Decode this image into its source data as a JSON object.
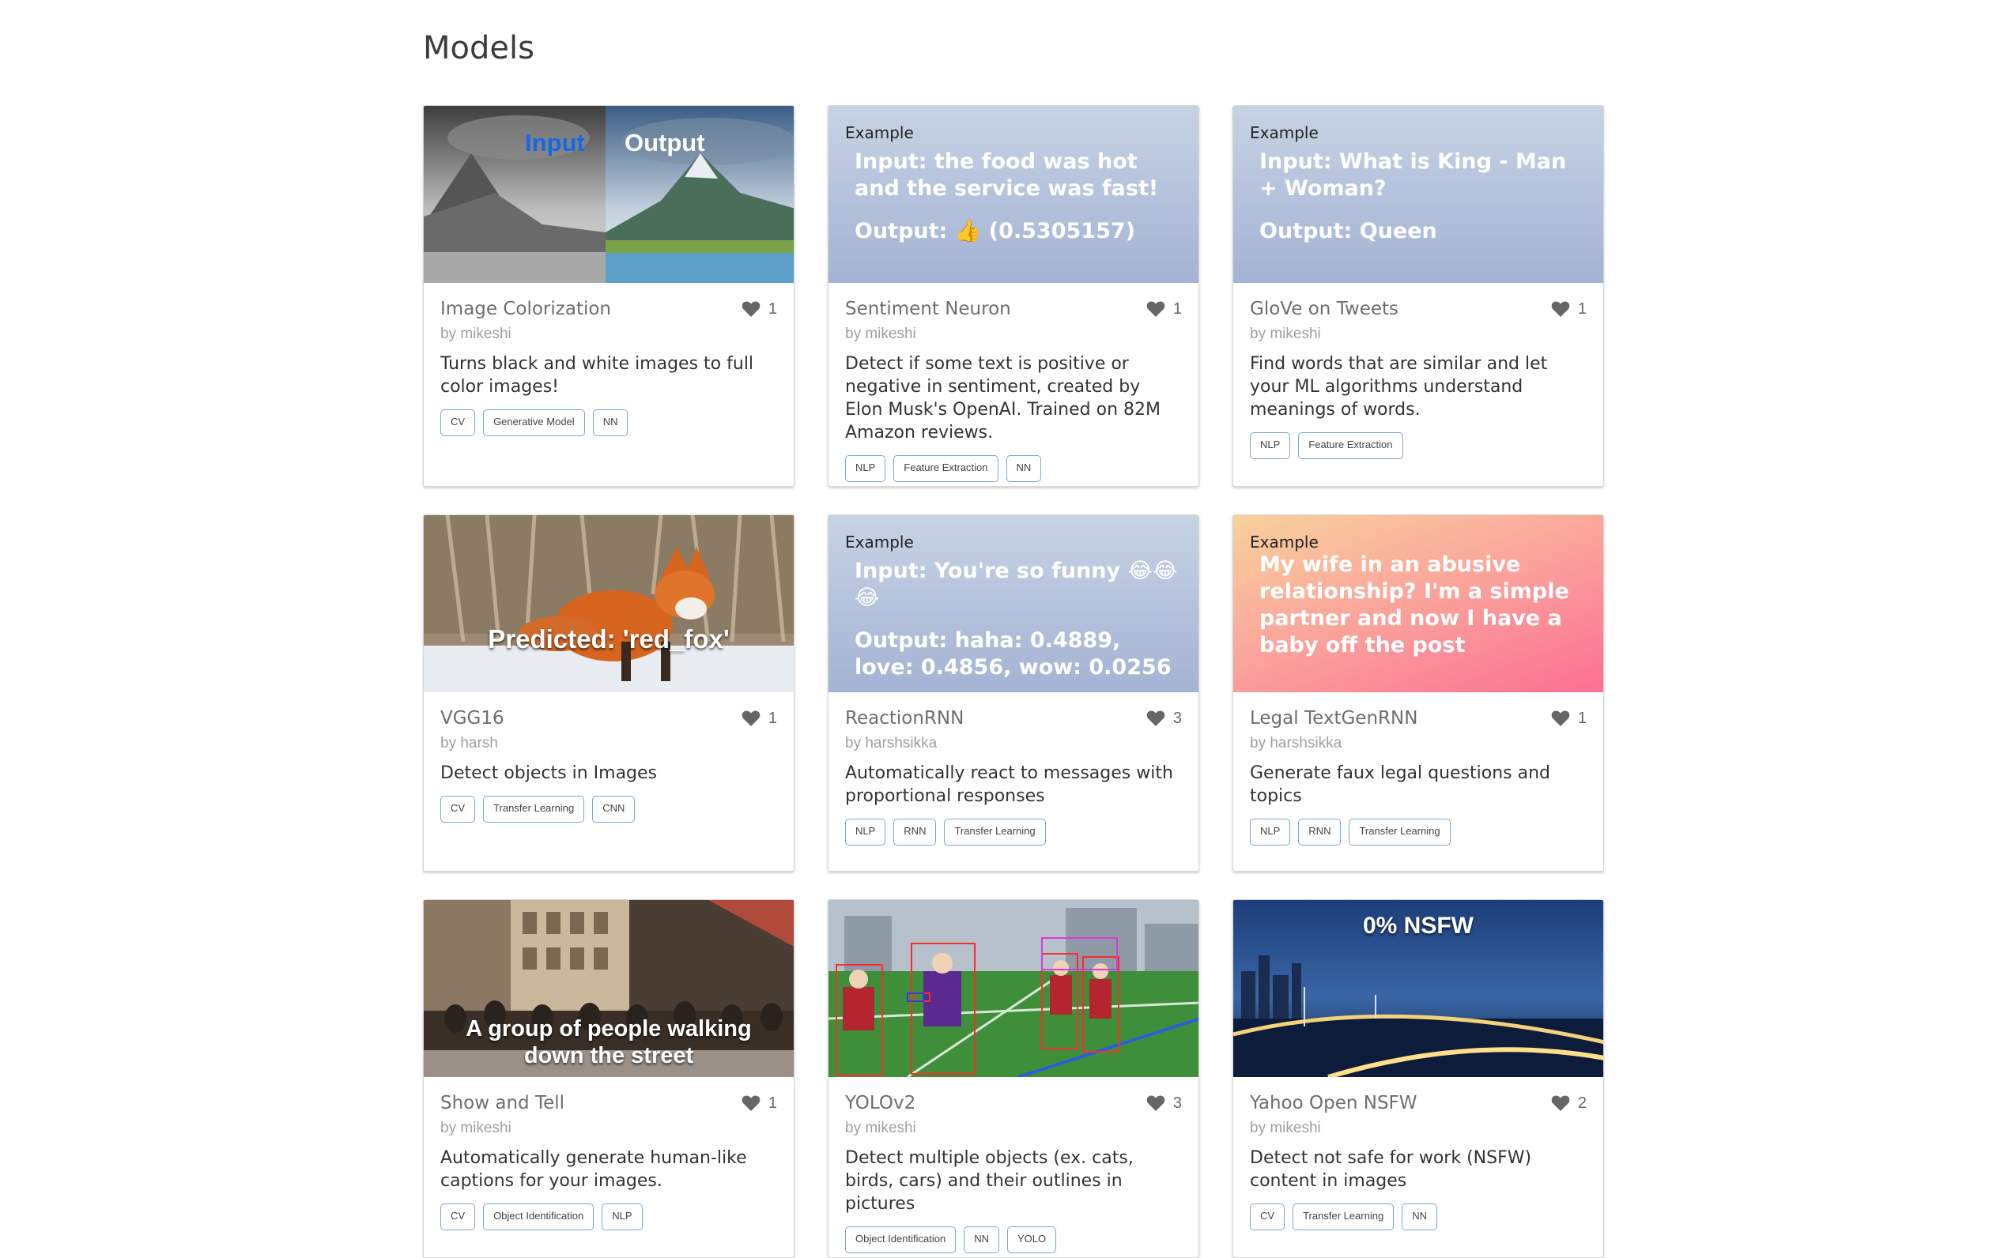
{
  "page": {
    "title": "Models"
  },
  "colors": {
    "tag_border": "#7aa7d8",
    "title": "#6e6e6e",
    "author": "#a0a0a0"
  },
  "cards": [
    {
      "title": "Image Colorization",
      "likes": "1",
      "author": "by mikeshi",
      "description": "Turns black and white images to full color images!",
      "tags": [
        "CV",
        "Generative Model",
        "NN"
      ],
      "image": {
        "input": "Input",
        "output": "Output"
      }
    },
    {
      "title": "Sentiment Neuron",
      "likes": "1",
      "author": "by mikeshi",
      "description": "Detect if some text is positive or negative in sentiment, created by Elon Musk's OpenAI. Trained on 82M Amazon reviews.",
      "tags": [
        "NLP",
        "Feature Extraction",
        "NN"
      ],
      "image": {
        "label": "Example",
        "line1": "Input: the food was hot and the service was fast!",
        "line2": "Output: 👍 (0.5305157)"
      }
    },
    {
      "title": "GloVe on Tweets",
      "likes": "1",
      "author": "by mikeshi",
      "description": "Find words that are similar and let your ML algorithms understand meanings of words.",
      "tags": [
        "NLP",
        "Feature Extraction"
      ],
      "image": {
        "label": "Example",
        "line1": "Input: What is King - Man + Woman?",
        "line2": "Output: Queen"
      }
    },
    {
      "title": "VGG16",
      "likes": "1",
      "author": "by harsh",
      "description": "Detect objects in Images",
      "tags": [
        "CV",
        "Transfer Learning",
        "CNN"
      ],
      "image": {
        "caption": "Predicted: 'red_fox'"
      }
    },
    {
      "title": "ReactionRNN",
      "likes": "3",
      "author": "by harshsikka",
      "description": "Automatically react to messages with proportional responses",
      "tags": [
        "NLP",
        "RNN",
        "Transfer Learning"
      ],
      "image": {
        "label": "Example",
        "line1": "Input: You're so funny 😂😂😂",
        "line2": "Output: haha: 0.4889, love: 0.4856, wow: 0.0256"
      }
    },
    {
      "title": "Legal TextGenRNN",
      "likes": "1",
      "author": "by harshsikka",
      "description": "Generate faux legal questions and topics",
      "tags": [
        "NLP",
        "RNN",
        "Transfer Learning"
      ],
      "image": {
        "label": "Example",
        "line1": "My wife in an abusive relationship? I'm a simple partner and now I have a baby off the post"
      }
    },
    {
      "title": "Show and Tell",
      "likes": "1",
      "author": "by mikeshi",
      "description": "Automatically generate human-like captions for your images.",
      "tags": [
        "CV",
        "Object Identification",
        "NLP"
      ],
      "image": {
        "caption": "A group of people walking down the street"
      }
    },
    {
      "title": "YOLOv2",
      "likes": "3",
      "author": "by mikeshi",
      "description": "Detect multiple objects (ex. cats, birds, cars) and their outlines in pictures",
      "tags": [
        "Object Identification",
        "NN",
        "YOLO"
      ],
      "image": {}
    },
    {
      "title": "Yahoo Open NSFW",
      "likes": "2",
      "author": "by mikeshi",
      "description": "Detect not safe for work (NSFW) content in images",
      "tags": [
        "CV",
        "Transfer Learning",
        "NN"
      ],
      "image": {
        "caption": "0% NSFW"
      }
    }
  ]
}
